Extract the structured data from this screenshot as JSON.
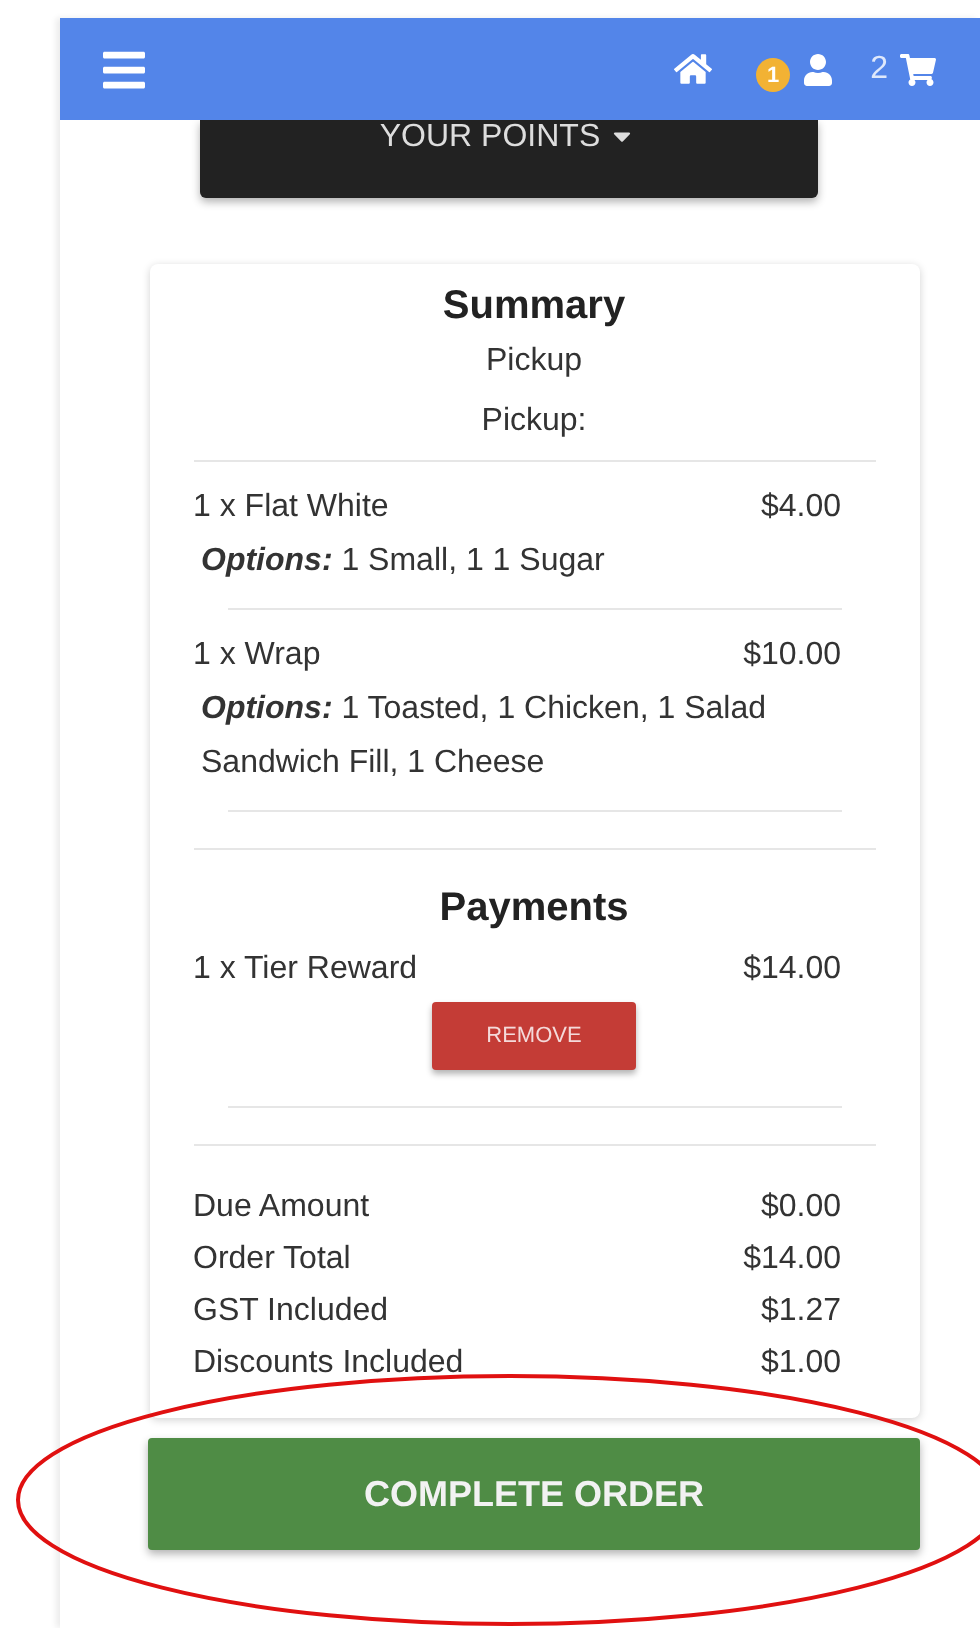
{
  "navbar": {
    "user_badge": "1",
    "cart_count": "2"
  },
  "points_menu": {
    "label": "YOUR POINTS"
  },
  "summary": {
    "title": "Summary",
    "order_type": "Pickup",
    "pickup_label": "Pickup:",
    "items": [
      {
        "name": "1 x Flat White",
        "price": "$4.00",
        "options": "**Options:** 1 Small, 1 1 Sugar"
      },
      {
        "name": "1 x Wrap",
        "price": "$10.00",
        "options": "**Options:** 1 Toasted, 1 Chicken, 1 Salad Sandwich Fill, 1 Cheese"
      }
    ]
  },
  "payments": {
    "title": "Payments",
    "items": [
      {
        "name": "1 x Tier Reward",
        "amount": "$14.00",
        "action": "REMOVE"
      }
    ]
  },
  "totals": [
    {
      "label": "Due Amount",
      "value": "$0.00"
    },
    {
      "label": "Order Total",
      "value": "$14.00"
    },
    {
      "label": "GST Included",
      "value": "$1.27"
    },
    {
      "label": "Discounts Included",
      "value": "$1.00"
    }
  ],
  "complete_button": "COMPLETE ORDER"
}
